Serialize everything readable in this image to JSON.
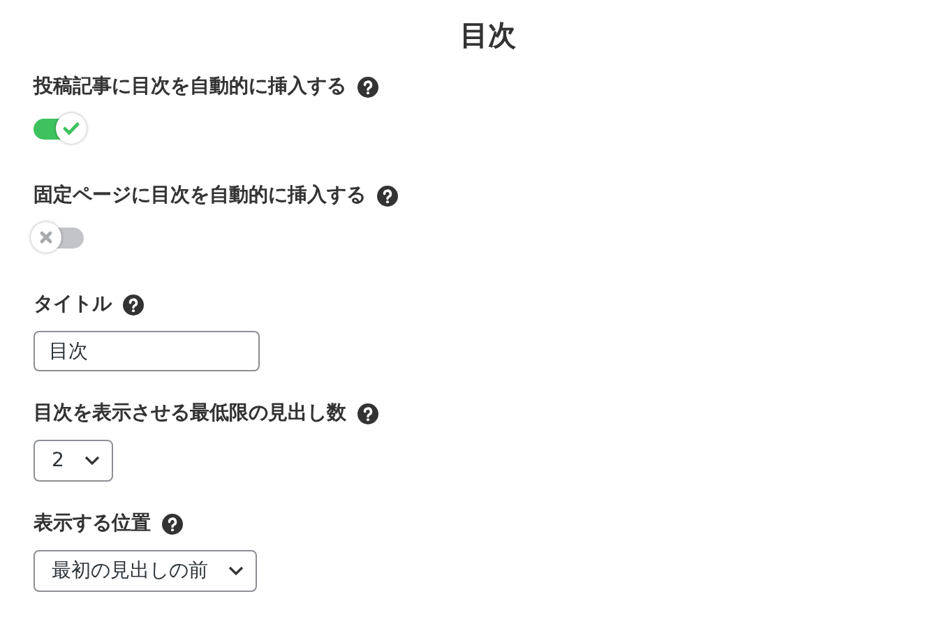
{
  "heading": "目次",
  "settings": [
    {
      "kind": "toggle",
      "label": "投稿記事に目次を自動的に挿入する",
      "on": true
    },
    {
      "kind": "toggle",
      "label": "固定ページに目次を自動的に挿入する",
      "on": false
    },
    {
      "kind": "text",
      "label": "タイトル",
      "value": "目次"
    },
    {
      "kind": "select",
      "label": "目次を表示させる最低限の見出し数",
      "value": "2"
    },
    {
      "kind": "select",
      "label": "表示する位置",
      "value": "最初の見出しの前"
    }
  ]
}
